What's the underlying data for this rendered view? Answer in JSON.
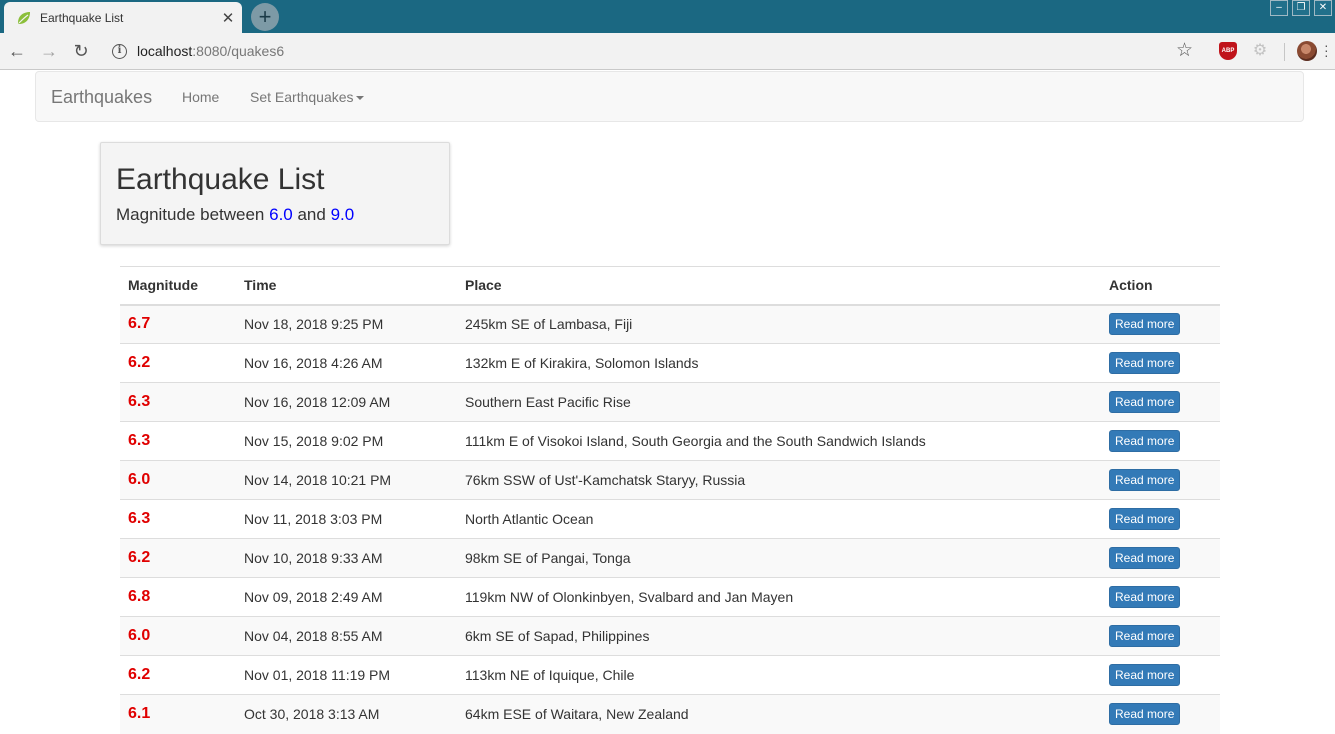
{
  "browser": {
    "tab_title": "Earthquake List",
    "new_tab": "+",
    "url_host": "localhost",
    "url_path": ":8080/quakes6",
    "close_glyph": "✕",
    "ext_label": "ABP"
  },
  "navbar": {
    "brand": "Earthquakes",
    "links": [
      "Home",
      "Set Earthquakes"
    ]
  },
  "jumbotron": {
    "title": "Earthquake List",
    "sub_prefix": "Magnitude between ",
    "min": "6.0",
    "sub_mid": " and ",
    "max": "9.0"
  },
  "table": {
    "columns": [
      "Magnitude",
      "Time",
      "Place",
      "Action"
    ],
    "action_label": "Read more",
    "rows": [
      {
        "mag": "6.7",
        "time": "Nov 18, 2018 9:25 PM",
        "place": "245km SE of Lambasa, Fiji"
      },
      {
        "mag": "6.2",
        "time": "Nov 16, 2018 4:26 AM",
        "place": "132km E of Kirakira, Solomon Islands"
      },
      {
        "mag": "6.3",
        "time": "Nov 16, 2018 12:09 AM",
        "place": "Southern East Pacific Rise"
      },
      {
        "mag": "6.3",
        "time": "Nov 15, 2018 9:02 PM",
        "place": "111km E of Visokoi Island, South Georgia and the South Sandwich Islands"
      },
      {
        "mag": "6.0",
        "time": "Nov 14, 2018 10:21 PM",
        "place": "76km SSW of Ust'-Kamchatsk Staryy, Russia"
      },
      {
        "mag": "6.3",
        "time": "Nov 11, 2018 3:03 PM",
        "place": "North Atlantic Ocean"
      },
      {
        "mag": "6.2",
        "time": "Nov 10, 2018 9:33 AM",
        "place": "98km SE of Pangai, Tonga"
      },
      {
        "mag": "6.8",
        "time": "Nov 09, 2018 2:49 AM",
        "place": "119km NW of Olonkinbyen, Svalbard and Jan Mayen"
      },
      {
        "mag": "6.0",
        "time": "Nov 04, 2018 8:55 AM",
        "place": "6km SE of Sapad, Philippines"
      },
      {
        "mag": "6.2",
        "time": "Nov 01, 2018 11:19 PM",
        "place": "113km NE of Iquique, Chile"
      },
      {
        "mag": "6.1",
        "time": "Oct 30, 2018 3:13 AM",
        "place": "64km ESE of Waitara, New Zealand"
      }
    ]
  }
}
